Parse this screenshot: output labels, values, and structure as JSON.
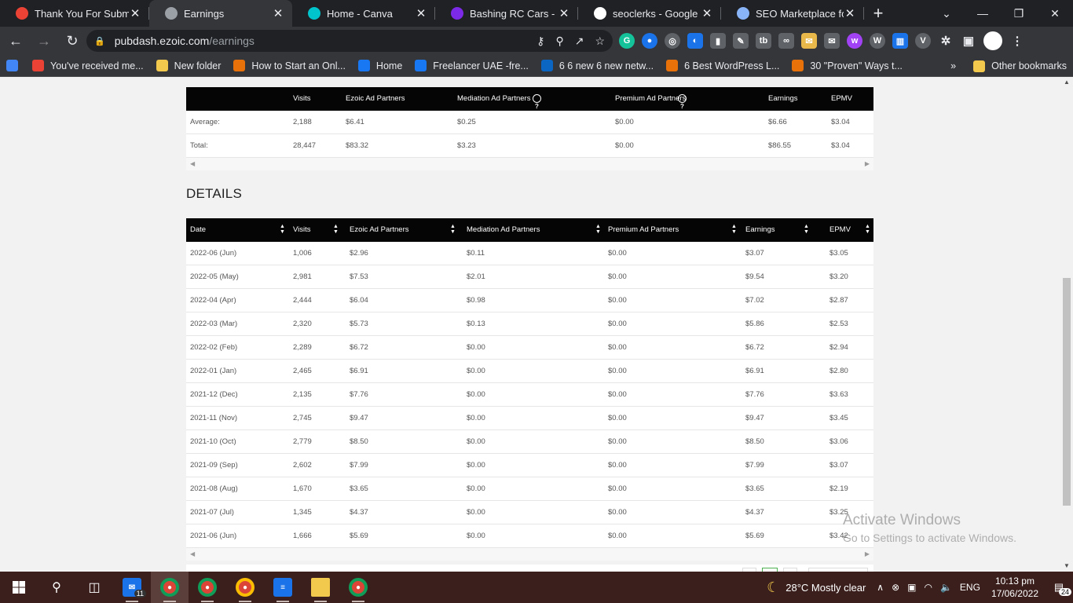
{
  "browser": {
    "tabs": [
      {
        "title": "Thank You For Submit",
        "icon": "gmail-icon",
        "color": "#ea4335",
        "active": false
      },
      {
        "title": "Earnings",
        "icon": "ezoic-icon",
        "color": "#9aa0a6",
        "active": true
      },
      {
        "title": "Home - Canva",
        "icon": "canva-icon",
        "color": "#00c4cc",
        "active": false
      },
      {
        "title": "Bashing RC Cars - You",
        "icon": "canva-icon",
        "color": "#7d2ae8",
        "active": false
      },
      {
        "title": "seoclerks - Google Se",
        "icon": "google-icon",
        "color": "#ffffff",
        "active": false
      },
      {
        "title": "SEO Marketplace for b",
        "icon": "seo-icon",
        "color": "#8ab4f8",
        "active": false
      }
    ],
    "new_tab": "+",
    "url_host": "pubdash.ezoic.com",
    "url_path": "/earnings",
    "bookmarks": [
      {
        "label": "",
        "icon": "google-icon",
        "color": "#4285f4"
      },
      {
        "label": "You've received me...",
        "icon": "gmail-icon",
        "color": "#ea4335"
      },
      {
        "label": "New folder",
        "icon": "folder-icon",
        "color": "#f2c94c"
      },
      {
        "label": "How to Start an Onl...",
        "icon": "blog-icon",
        "color": "#e8710a"
      },
      {
        "label": "Home",
        "icon": "facebook-icon",
        "color": "#1877f2"
      },
      {
        "label": "Freelancer UAE -fre...",
        "icon": "facebook-icon",
        "color": "#1877f2"
      },
      {
        "label": "6 6 new 6 new netw...",
        "icon": "linkedin-icon",
        "color": "#0a66c2"
      },
      {
        "label": "6 Best WordPress L...",
        "icon": "blog-icon",
        "color": "#e8710a"
      },
      {
        "label": "30 \"Proven\" Ways t...",
        "icon": "blog-icon",
        "color": "#e8710a"
      }
    ],
    "bookmarks_overflow": "»",
    "other_bookmarks": "Other bookmarks"
  },
  "summary": {
    "headers": [
      "",
      "Visits",
      "Ezoic Ad Partners",
      "Mediation Ad Partners",
      "Premium Ad Partners",
      "Earnings",
      "EPMV"
    ],
    "rows": [
      [
        "Average:",
        "2,188",
        "$6.41",
        "$0.25",
        "$0.00",
        "$6.66",
        "$3.04"
      ],
      [
        "Total:",
        "28,447",
        "$83.32",
        "$3.23",
        "$0.00",
        "$86.55",
        "$3.04"
      ]
    ]
  },
  "details": {
    "title": "DETAILS",
    "headers": [
      "Date",
      "Visits",
      "Ezoic Ad Partners",
      "Mediation Ad Partners",
      "Premium Ad Partners",
      "Earnings",
      "EPMV"
    ],
    "rows": [
      [
        "2022-06 (Jun)",
        "1,006",
        "$2.96",
        "$0.11",
        "$0.00",
        "$3.07",
        "$3.05"
      ],
      [
        "2022-05 (May)",
        "2,981",
        "$7.53",
        "$2.01",
        "$0.00",
        "$9.54",
        "$3.20"
      ],
      [
        "2022-04 (Apr)",
        "2,444",
        "$6.04",
        "$0.98",
        "$0.00",
        "$7.02",
        "$2.87"
      ],
      [
        "2022-03 (Mar)",
        "2,320",
        "$5.73",
        "$0.13",
        "$0.00",
        "$5.86",
        "$2.53"
      ],
      [
        "2022-02 (Feb)",
        "2,289",
        "$6.72",
        "$0.00",
        "$0.00",
        "$6.72",
        "$2.94"
      ],
      [
        "2022-01 (Jan)",
        "2,465",
        "$6.91",
        "$0.00",
        "$0.00",
        "$6.91",
        "$2.80"
      ],
      [
        "2021-12 (Dec)",
        "2,135",
        "$7.76",
        "$0.00",
        "$0.00",
        "$7.76",
        "$3.63"
      ],
      [
        "2021-11 (Nov)",
        "2,745",
        "$9.47",
        "$0.00",
        "$0.00",
        "$9.47",
        "$3.45"
      ],
      [
        "2021-10 (Oct)",
        "2,779",
        "$8.50",
        "$0.00",
        "$0.00",
        "$8.50",
        "$3.06"
      ],
      [
        "2021-09 (Sep)",
        "2,602",
        "$7.99",
        "$0.00",
        "$0.00",
        "$7.99",
        "$3.07"
      ],
      [
        "2021-08 (Aug)",
        "1,670",
        "$3.65",
        "$0.00",
        "$0.00",
        "$3.65",
        "$2.19"
      ],
      [
        "2021-07 (Jul)",
        "1,345",
        "$4.37",
        "$0.00",
        "$0.00",
        "$4.37",
        "$3.25"
      ],
      [
        "2021-06 (Jun)",
        "1,666",
        "$5.69",
        "$0.00",
        "$0.00",
        "$5.69",
        "$3.42"
      ]
    ]
  },
  "watermark": {
    "line1": "Activate Windows",
    "line2": "Go to Settings to activate Windows."
  },
  "taskbar": {
    "mail_badge": "11",
    "weather": "28°C  Mostly clear",
    "language": "ENG",
    "time": "10:13 pm",
    "date": "17/06/2022",
    "notification_count": "24"
  }
}
